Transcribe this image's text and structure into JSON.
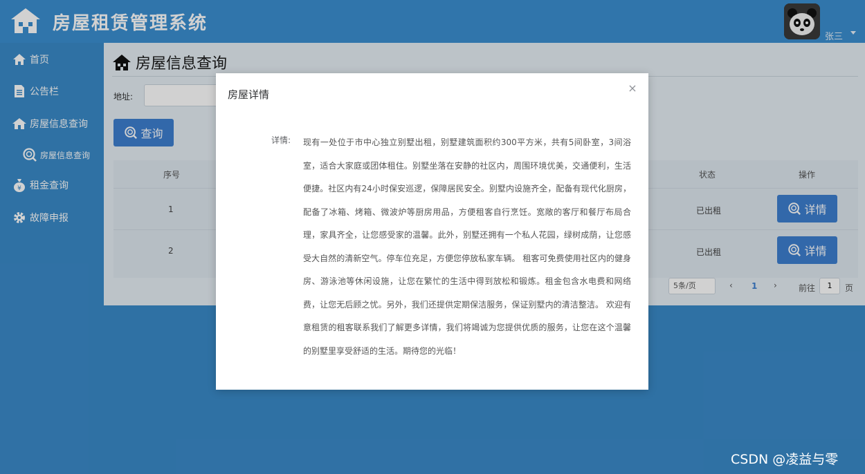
{
  "header": {
    "app_title": "房屋租赁管理系统",
    "user_name": "张三",
    "logo_icon": "house-logo-icon",
    "avatar_icon": "panda-avatar"
  },
  "sidebar": {
    "items": [
      {
        "label": "首页",
        "icon": "home-icon"
      },
      {
        "label": "公告栏",
        "icon": "document-icon"
      },
      {
        "label": "房屋信息查询",
        "icon": "house-icon"
      },
      {
        "label": "房屋信息查询",
        "icon": "search-icon"
      },
      {
        "label": "租金查询",
        "icon": "money-bag-icon"
      },
      {
        "label": "故障申报",
        "icon": "gear-icon"
      }
    ]
  },
  "main": {
    "page_title": "房屋信息查询",
    "address_label": "地址:",
    "address_value": "",
    "query_button": "查询",
    "table": {
      "columns": [
        "序号",
        "状态",
        "操作"
      ],
      "rows": [
        {
          "index": "1",
          "status": "已出租",
          "action": "详情"
        },
        {
          "index": "2",
          "status": "已出租",
          "action": "详情"
        }
      ]
    },
    "pager": {
      "page_size": "5条/页",
      "prev": "‹",
      "current": "1",
      "next": "›",
      "goto_label": "前往",
      "goto_value": "1",
      "page_suffix": "页"
    }
  },
  "modal": {
    "title": "房屋详情",
    "close_symbol": "×",
    "detail_label": "详情:",
    "detail_text": "现有一处位于市中心独立别墅出租，别墅建筑面积约300平方米，共有5间卧室，3间浴室，适合大家庭或团体租住。别墅坐落在安静的社区内，周围环境优美，交通便利，生活便捷。社区内有24小时保安巡逻，保障居民安全。别墅内设施齐全，配备有现代化厨房，配备了冰箱、烤箱、微波炉等厨房用品，方便租客自行烹饪。宽敞的客厅和餐厅布局合理，家具齐全，让您感受家的温馨。此外，别墅还拥有一个私人花园，绿树成荫，让您感受大自然的清新空气。停车位充足，方便您停放私家车辆。 租客可免费使用社区内的健身房、游泳池等休闲设施，让您在繁忙的生活中得到放松和锻炼。租金包含水电费和网络费，让您无后顾之忧。另外，我们还提供定期保洁服务，保证别墅内的清洁整洁。 欢迎有意租赁的租客联系我们了解更多详情，我们将竭诚为您提供优质的服务，让您在这个温馨的别墅里享受舒适的生活。期待您的光临！"
  },
  "watermark": "CSDN @凌益与零",
  "colors": {
    "header_bg": "#3b8fd1",
    "sidebar_bg": "#3a8ac9",
    "primary_button": "#3d7fd0",
    "content_bg": "#e6eef5"
  }
}
